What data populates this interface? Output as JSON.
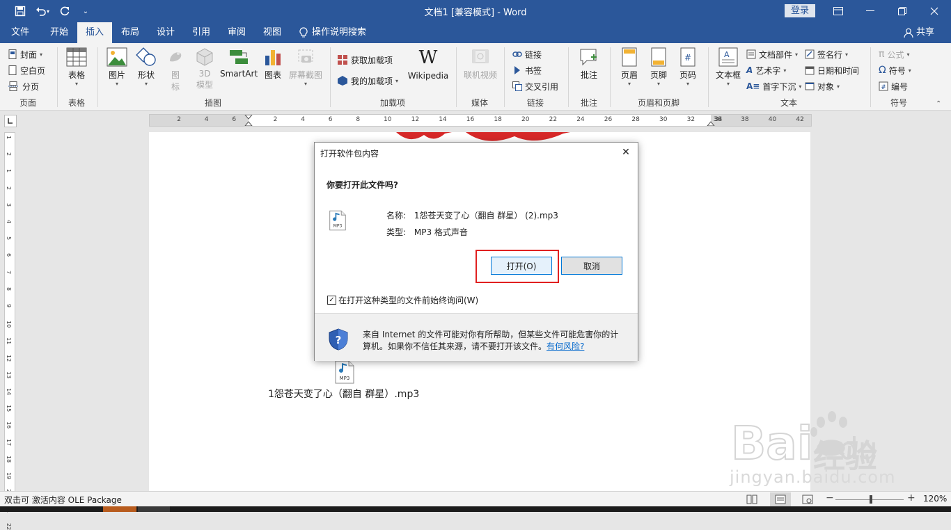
{
  "window": {
    "title": "文档1 [兼容模式] - Word",
    "login_label": "登录"
  },
  "tabs": [
    {
      "label": "文件"
    },
    {
      "label": "开始"
    },
    {
      "label": "插入"
    },
    {
      "label": "布局"
    },
    {
      "label": "设计"
    },
    {
      "label": "引用"
    },
    {
      "label": "审阅"
    },
    {
      "label": "视图"
    }
  ],
  "tell_me": "操作说明搜索",
  "share_label": "共享",
  "ribbon": {
    "pages": {
      "cover": "封面",
      "blank": "空白页",
      "break": "分页",
      "group": "页面"
    },
    "tables": {
      "table": "表格",
      "group": "表格"
    },
    "illustrations": {
      "picture": "图片",
      "shapes": "形状",
      "icons_1": "图",
      "icons_2": "标",
      "model_1": "3D",
      "model_2": "模型",
      "smartart": "SmartArt",
      "chart": "图表",
      "screenshot": "屏幕截图",
      "group": "插图"
    },
    "addins": {
      "get": "获取加载项",
      "mine": "我的加载项",
      "wikipedia": "Wikipedia",
      "group": "加载项"
    },
    "media": {
      "video": "联机视频",
      "group": "媒体"
    },
    "links": {
      "link": "链接",
      "bookmark": "书签",
      "crossref": "交叉引用",
      "group": "链接"
    },
    "comments": {
      "comment": "批注",
      "group": "批注"
    },
    "header_footer": {
      "header": "页眉",
      "footer": "页脚",
      "page_number": "页码",
      "group": "页眉和页脚"
    },
    "text": {
      "textbox": "文本框",
      "quickparts": "文档部件",
      "wordart": "艺术字",
      "dropcap": "首字下沉",
      "signature": "签名行",
      "datetime": "日期和时间",
      "object": "对象",
      "group": "文本"
    },
    "symbols": {
      "equation": "公式",
      "symbol": "符号",
      "number": "编号",
      "group": "符号"
    }
  },
  "ruler": {
    "left_ticks": [
      "6",
      "4",
      "2"
    ],
    "right_ticks": [
      "2",
      "4",
      "6",
      "8",
      "10",
      "12",
      "14",
      "16",
      "18",
      "20",
      "22",
      "24",
      "26",
      "28",
      "30",
      "32",
      "34"
    ],
    "margin_ticks": [
      "36",
      "38",
      "40",
      "42"
    ],
    "vertical_ticks": [
      "1",
      "2",
      "1",
      "2",
      "3",
      "4",
      "5",
      "6",
      "7",
      "8",
      "9",
      "10",
      "11",
      "12",
      "13",
      "14",
      "15",
      "16",
      "17",
      "18",
      "19",
      "20",
      "21",
      "22"
    ]
  },
  "document": {
    "caption": "1怨苍天变了心（翻自 群星）.mp3"
  },
  "dialog": {
    "title": "打开软件包内容",
    "question": "你要打开此文件吗?",
    "name_label": "名称:",
    "name_value": "1怨苍天变了心（翻自 群星） (2).mp3",
    "type_label": "类型:",
    "type_value": "MP3 格式声音",
    "open_button": "打开(O)",
    "cancel_button": "取消",
    "checkbox_label": "在打开这种类型的文件前始终询问(W)",
    "checkbox_checked": true,
    "warning_text": "来自 Internet 的文件可能对你有所帮助，但某些文件可能危害你的计算机。如果你不信任其来源，请不要打开该文件。",
    "risk_link": "有何风险?"
  },
  "mp3_icon_label": "MP3",
  "statusbar": {
    "text": "双击可 激活内容 OLE Package",
    "zoom": "120%"
  },
  "watermark": {
    "brand": "Bai",
    "brand2": "du",
    "cn": "经验",
    "url": "jingyan.baidu.com"
  },
  "colors": {
    "word_blue": "#2b579a",
    "highlight_red": "#e02020",
    "link_blue": "#0066cc"
  }
}
